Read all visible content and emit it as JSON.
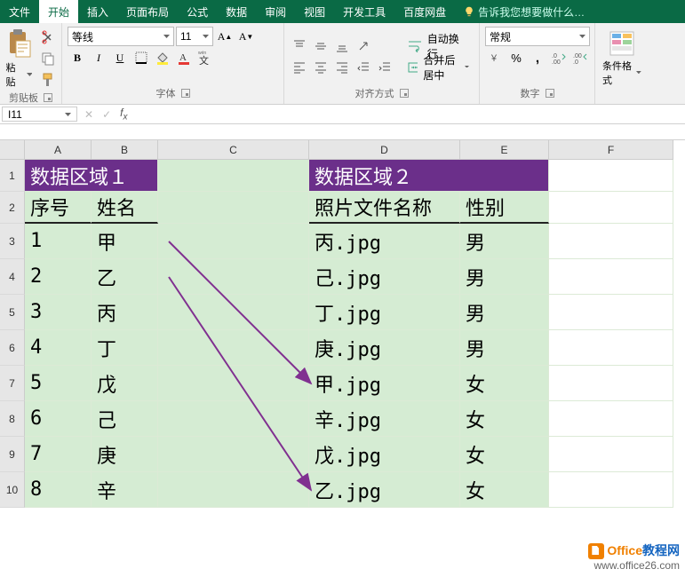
{
  "menu": {
    "items": [
      "文件",
      "开始",
      "插入",
      "页面布局",
      "公式",
      "数据",
      "审阅",
      "视图",
      "开发工具",
      "百度网盘"
    ],
    "active_index": 1,
    "tell_me": "告诉我您想要做什么…"
  },
  "ribbon": {
    "clipboard": {
      "paste": "粘贴",
      "label": "剪贴板"
    },
    "font": {
      "name": "等线",
      "size": "11",
      "label": "字体",
      "bold": "B",
      "italic": "I",
      "underline": "U"
    },
    "alignment": {
      "wrap": "自动换行",
      "merge": "合并后居中",
      "label": "对齐方式"
    },
    "number": {
      "format": "常规",
      "label": "数字"
    },
    "styles": {
      "cond": "条件格式"
    }
  },
  "fx": {
    "name_box": "I11",
    "formula": ""
  },
  "columns": [
    "A",
    "B",
    "C",
    "D",
    "E",
    "F"
  ],
  "region1": {
    "title": "数据区域１",
    "headers": [
      "序号",
      "姓名"
    ],
    "rows": [
      [
        "1",
        "甲"
      ],
      [
        "2",
        "乙"
      ],
      [
        "3",
        "丙"
      ],
      [
        "4",
        "丁"
      ],
      [
        "5",
        "戊"
      ],
      [
        "6",
        "己"
      ],
      [
        "7",
        "庚"
      ],
      [
        "8",
        "辛"
      ]
    ]
  },
  "region2": {
    "title": "数据区域２",
    "headers": [
      "照片文件名称",
      "性别"
    ],
    "rows": [
      [
        "丙.jpg",
        "男"
      ],
      [
        "己.jpg",
        "男"
      ],
      [
        "丁.jpg",
        "男"
      ],
      [
        "庚.jpg",
        "男"
      ],
      [
        "甲.jpg",
        "女"
      ],
      [
        "辛.jpg",
        "女"
      ],
      [
        "戊.jpg",
        "女"
      ],
      [
        "乙.jpg",
        "女"
      ]
    ]
  },
  "watermark": {
    "line1a": "Office",
    "line1b": "教程网",
    "line2": "www.office26.com"
  }
}
